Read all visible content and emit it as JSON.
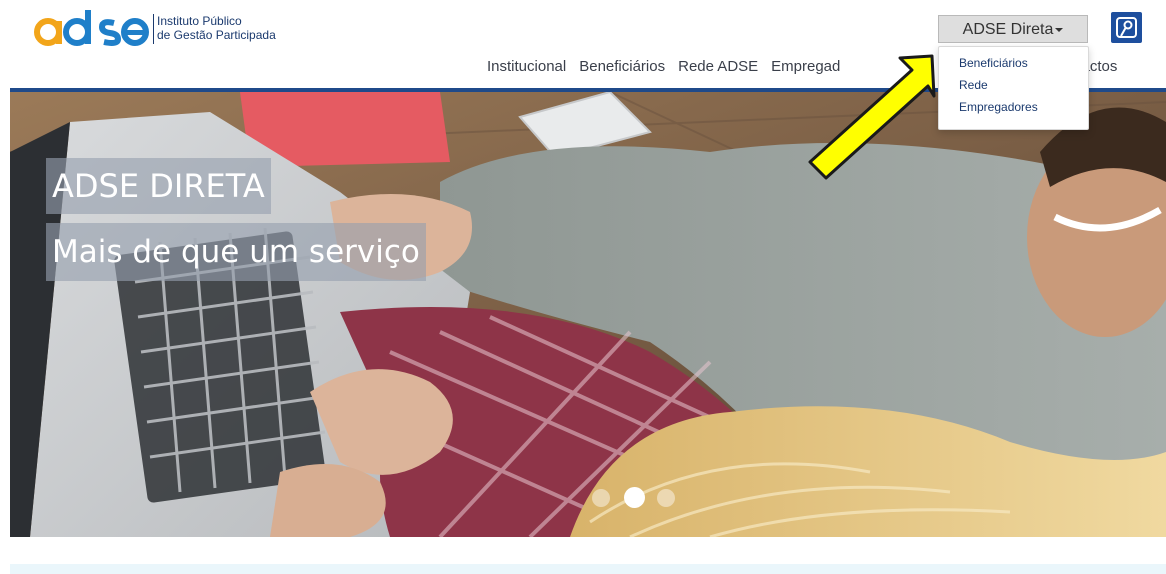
{
  "brand": {
    "logo_text": "adse",
    "org_line1": "Instituto Público",
    "org_line2": "de Gestão Participada",
    "colors": {
      "logo_orange": "#f2a51a",
      "logo_blue": "#1f7fc9",
      "logo_navy": "#1b3a6e"
    }
  },
  "nav": {
    "items": [
      "Institucional",
      "Beneficiários",
      "Rede ADSE",
      "Empregad",
      "ntactos"
    ]
  },
  "direta": {
    "label": "ADSE Direta",
    "menu": [
      "Beneficiários",
      "Rede",
      "Empregadores"
    ]
  },
  "user_button": {
    "icon": "user-login-icon"
  },
  "hero": {
    "title": "ADSE DIRETA",
    "subtitle": "Mais de que um serviço",
    "slides_count": 3,
    "active_slide": 2
  },
  "annotation": {
    "icon": "arrow-pointer-icon",
    "color": "#ffff00"
  },
  "theme": {
    "accent": "#1f4a8a",
    "button_bg": "#dedede"
  }
}
